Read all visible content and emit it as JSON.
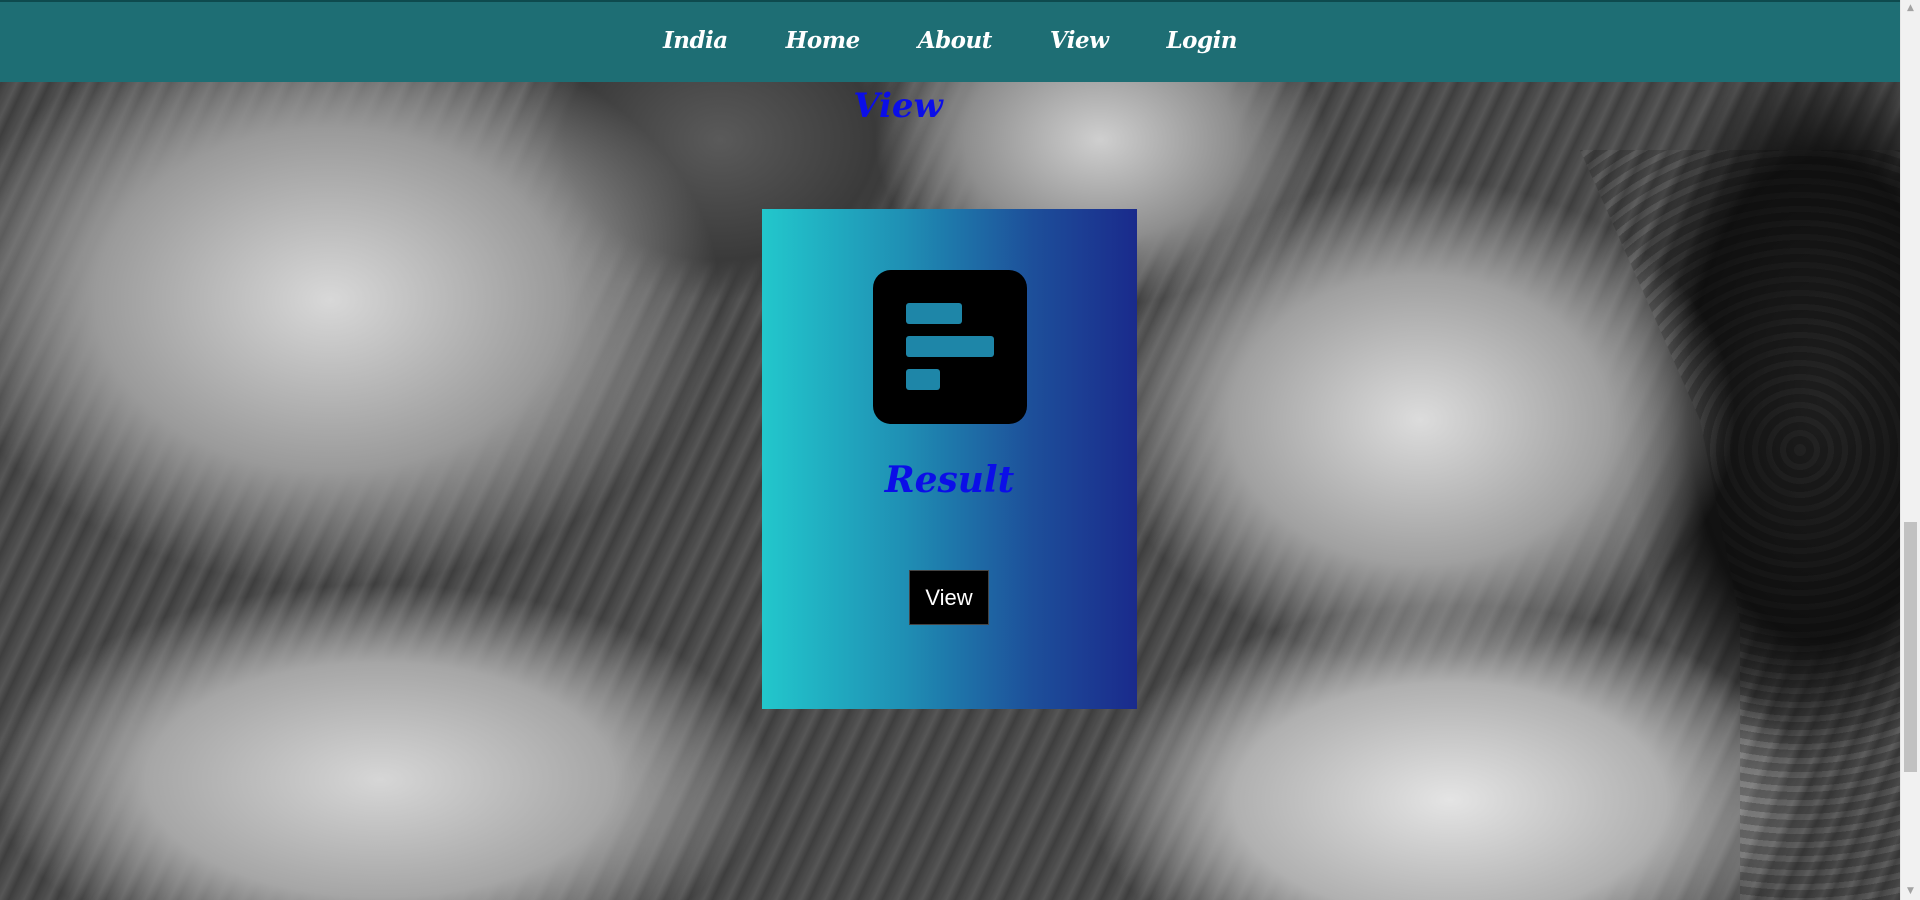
{
  "navbar": {
    "items": [
      {
        "label": "India"
      },
      {
        "label": "Home"
      },
      {
        "label": "About"
      },
      {
        "label": "View"
      },
      {
        "label": "Login"
      }
    ]
  },
  "section": {
    "title": "View"
  },
  "card": {
    "icon": "bar-chart-horizontal-icon",
    "title": "Result",
    "button_label": "View"
  },
  "colors": {
    "navbar": "#1e6e74",
    "title_blue": "#0b0ee8",
    "card_gradient_start": "#22c7cc",
    "card_gradient_end": "#1a2a8c",
    "button_bg": "#000000"
  },
  "background": {
    "description_icon": "hands-photo"
  }
}
